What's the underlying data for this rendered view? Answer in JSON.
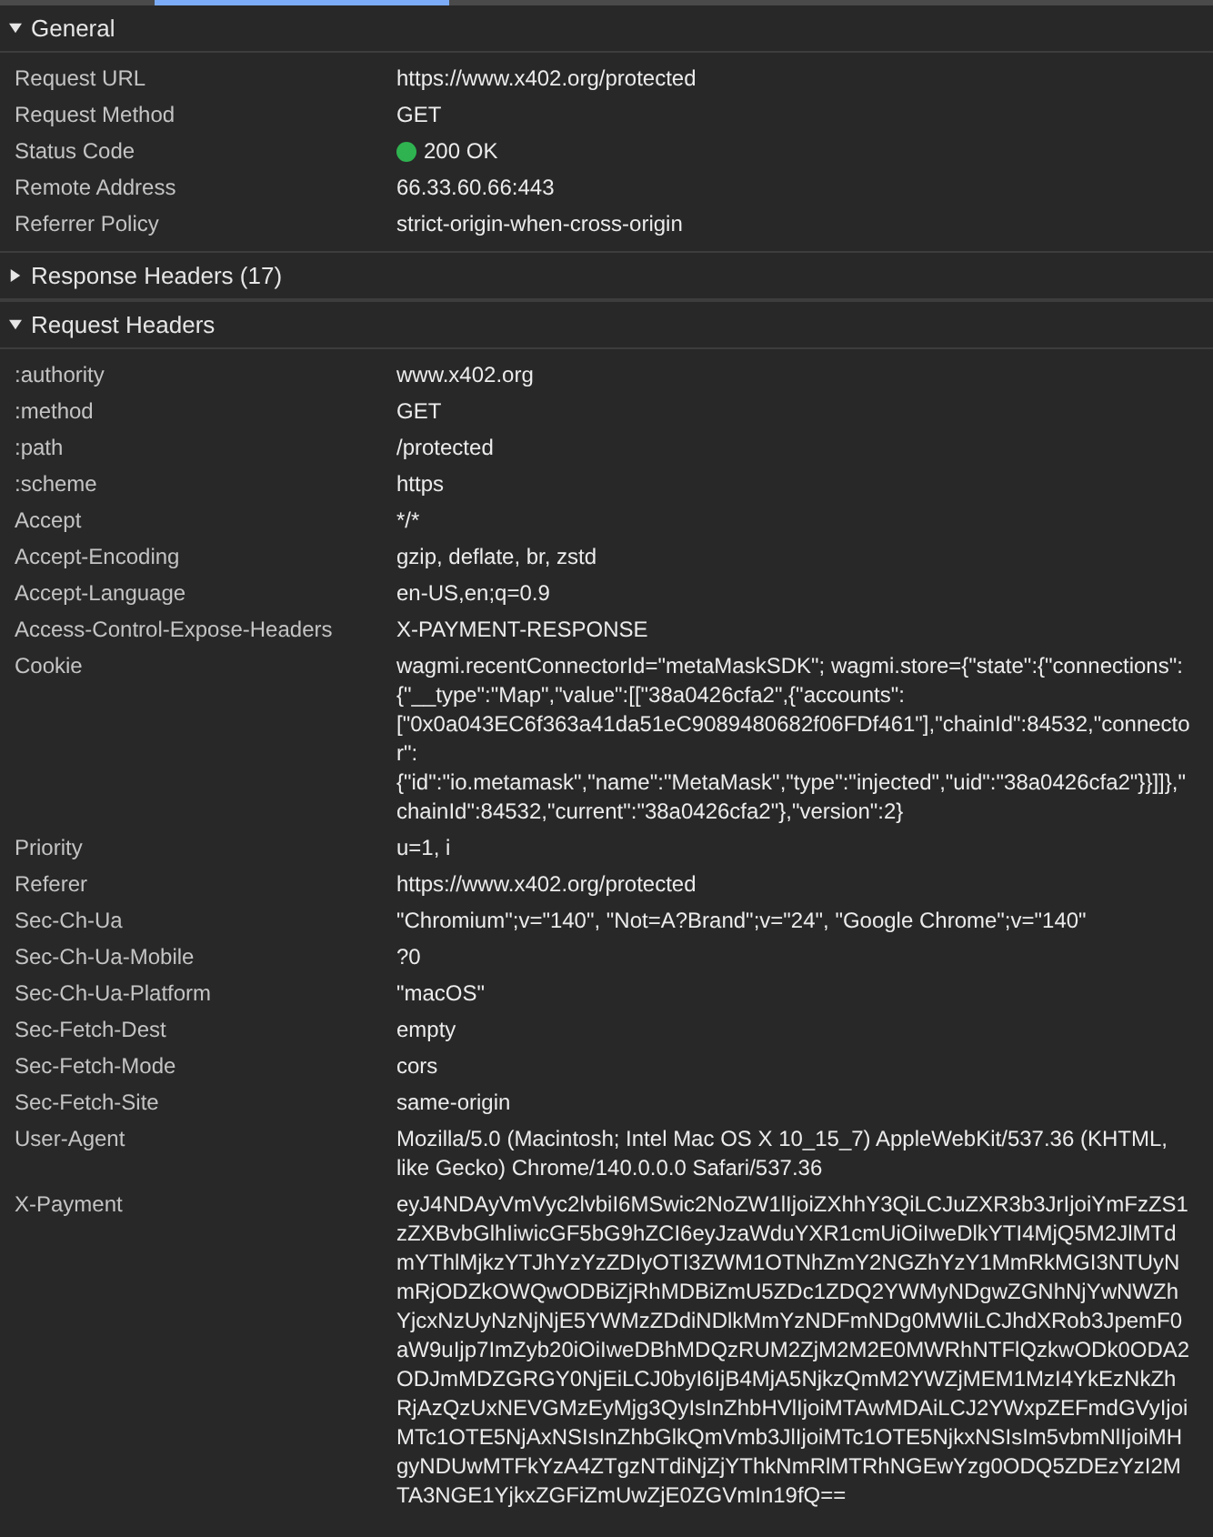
{
  "sections": [
    {
      "title": "General",
      "expanded": true,
      "rows": [
        {
          "kind": "plain",
          "name": "Request URL",
          "value": "https://www.x402.org/protected"
        },
        {
          "kind": "plain",
          "name": "Request Method",
          "value": "GET"
        },
        {
          "kind": "status",
          "name": "Status Code",
          "value": "200 OK",
          "color": "#2fb350"
        },
        {
          "kind": "plain",
          "name": "Remote Address",
          "value": "66.33.60.66:443"
        },
        {
          "kind": "plain",
          "name": "Referrer Policy",
          "value": "strict-origin-when-cross-origin"
        }
      ]
    },
    {
      "title": "Response Headers (17)",
      "expanded": false
    },
    {
      "title": "Request Headers",
      "expanded": true,
      "rows": [
        {
          "kind": "plain",
          "name": ":authority",
          "value": "www.x402.org"
        },
        {
          "kind": "plain",
          "name": ":method",
          "value": "GET"
        },
        {
          "kind": "plain",
          "name": ":path",
          "value": "/protected"
        },
        {
          "kind": "plain",
          "name": ":scheme",
          "value": "https"
        },
        {
          "kind": "plain",
          "name": "Accept",
          "value": "*/*"
        },
        {
          "kind": "plain",
          "name": "Accept-Encoding",
          "value": "gzip, deflate, br, zstd"
        },
        {
          "kind": "plain",
          "name": "Accept-Language",
          "value": "en-US,en;q=0.9"
        },
        {
          "kind": "plain",
          "name": "Access-Control-Expose-Headers",
          "value": "X-PAYMENT-RESPONSE"
        },
        {
          "kind": "plain",
          "name": "Cookie",
          "value": "wagmi.recentConnectorId=\"metaMaskSDK\"; wagmi.store={\"state\":{\"connections\":{\"__type\":\"Map\",\"value\":[[\"38a0426cfa2\",{\"accounts\":[\"0x0a043EC6f363a41da51eC9089480682f06FDf461\"],\"chainId\":84532,\"connector\":{\"id\":\"io.metamask\",\"name\":\"MetaMask\",\"type\":\"injected\",\"uid\":\"38a0426cfa2\"}}]]},\"chainId\":84532,\"current\":\"38a0426cfa2\"},\"version\":2}"
        },
        {
          "kind": "plain",
          "name": "Priority",
          "value": "u=1, i"
        },
        {
          "kind": "plain",
          "name": "Referer",
          "value": "https://www.x402.org/protected"
        },
        {
          "kind": "plain",
          "name": "Sec-Ch-Ua",
          "value": "\"Chromium\";v=\"140\", \"Not=A?Brand\";v=\"24\", \"Google Chrome\";v=\"140\""
        },
        {
          "kind": "plain",
          "name": "Sec-Ch-Ua-Mobile",
          "value": "?0"
        },
        {
          "kind": "plain",
          "name": "Sec-Ch-Ua-Platform",
          "value": "\"macOS\""
        },
        {
          "kind": "plain",
          "name": "Sec-Fetch-Dest",
          "value": "empty"
        },
        {
          "kind": "plain",
          "name": "Sec-Fetch-Mode",
          "value": "cors"
        },
        {
          "kind": "plain",
          "name": "Sec-Fetch-Site",
          "value": "same-origin"
        },
        {
          "kind": "plain",
          "name": "User-Agent",
          "value": "Mozilla/5.0 (Macintosh; Intel Mac OS X 10_15_7) AppleWebKit/537.36 (KHTML, like Gecko) Chrome/140.0.0.0 Safari/537.36"
        },
        {
          "kind": "plain",
          "name": "X-Payment",
          "value": "eyJ4NDAyVmVyc2lvbiI6MSwic2NoZW1lIjoiZXhhY3QiLCJuZXR3b3JrIjoiYmFzZS1zZXBvbGlhIiwicGF5bG9hZCI6eyJzaWduYXR1cmUiOiIweDlkYTI4MjQ5M2JlMTdmYThlMjkzYTJhYzYzZDIyOTI3ZWM1OTNhZmY2NGZhYzY1MmRkMGI3NTUyNmRjODZkOWQwODBiZjRhMDBiZmU5ZDc1ZDQ2YWMyNDgwZGNhNjYwNWZhYjcxNzUyNzNjNjE5YWMzZDdiNDlkMmYzNDFmNDg0MWIiLCJhdXRob3JpemF0aW9uIjp7ImZyb20iOiIweDBhMDQzRUM2ZjM2M2E0MWRhNTFlQzkwODk0ODA2ODJmMDZGRGY0NjEiLCJ0byI6IjB4MjA5NjkzQmM2YWZjMEM1MzI4YkEzNkZhRjAzQzUxNEVGMzEyMjg3QyIsInZhbHVlIjoiMTAwMDAiLCJ2YWxpZEFmdGVyIjoiMTc1OTE5NjAxNSIsInZhbGlkQmVmb3JlIjoiMTc1OTE5NjkxNSIsIm5vbmNlIjoiMHgyNDUwMTFkYzA4ZTgzNTdiNjZjYThkNmRlMTRhNGEwYzg0ODQ5ZDEzYzI2MTA3NGE1YjkxZGFiZmUwZjE0ZGVmIn19fQ=="
        }
      ]
    }
  ]
}
